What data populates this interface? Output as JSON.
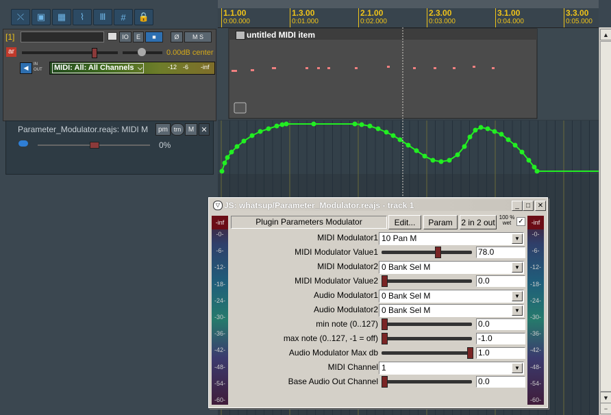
{
  "toolbar": {
    "icons": [
      "ripple-icon",
      "snap-icon",
      "grid-icon",
      "envelope-icon",
      "metronome-icon",
      "grid-lines-icon",
      "lock-icon"
    ]
  },
  "track": {
    "number": "[1]",
    "name_value": "",
    "arm_label": "ar",
    "volume_readout": "0.00dB center",
    "input_label": "MIDI: All: All Channels",
    "io_in": "IN",
    "io_out": "OUT",
    "meter_labels": [
      "-12",
      "-6",
      "-inf"
    ],
    "btn_io": "IO",
    "btn_e": "E",
    "btn_ms": "M S"
  },
  "fx": {
    "name": "Parameter_Modulator.reajs: MIDI M",
    "pm": "pm",
    "trn": "trn",
    "m": "M",
    "percent": "0%"
  },
  "ruler": {
    "marks": [
      {
        "label": "1.1.00",
        "sub": "0:00.000"
      },
      {
        "label": "1.3.00",
        "sub": "0:01.000"
      },
      {
        "label": "2.1.00",
        "sub": "0:02.000"
      },
      {
        "label": "2.3.00",
        "sub": "0:03.000"
      },
      {
        "label": "3.1.00",
        "sub": "0:04.000"
      },
      {
        "label": "3.3.00",
        "sub": "0:05.000"
      }
    ]
  },
  "midi_item": {
    "title": "untitled MIDI item"
  },
  "plugin": {
    "title": "JS: whatsup/Parameter_Modulator.reajs - track 1",
    "header_label": "Plugin Parameters Modulator",
    "btn_edit": "Edit...",
    "btn_param": "Param",
    "btn_io": "2 in 2 out",
    "wet_label": "100 % wet",
    "params": [
      {
        "label": "MIDI Modulator1",
        "type": "combo",
        "value": "10 Pan M"
      },
      {
        "label": "MIDI Modulator Value1",
        "type": "slider",
        "value": "78.0",
        "pos": 0.62
      },
      {
        "label": "MIDI Modulator2",
        "type": "combo",
        "value": "0 Bank Sel M"
      },
      {
        "label": "MIDI Modulator Value2",
        "type": "slider",
        "value": "0.0",
        "pos": 0.0
      },
      {
        "label": "Audio Modulator1",
        "type": "combo",
        "value": "0 Bank Sel M"
      },
      {
        "label": "Audio Modulator2",
        "type": "combo",
        "value": "0 Bank Sel M"
      },
      {
        "label": "min note (0..127)",
        "type": "slider",
        "value": "0.0",
        "pos": 0.0
      },
      {
        "label": "max note (0..127, -1 = off)",
        "type": "slider",
        "value": "-1.0",
        "pos": 0.0
      },
      {
        "label": "Audio Modulator Max db",
        "type": "slider",
        "value": "1.0",
        "pos": 1.0
      },
      {
        "label": "MIDI Channel",
        "type": "combo",
        "value": "1"
      },
      {
        "label": "Base Audio Out Channel",
        "type": "slider",
        "value": "0.0",
        "pos": 0.0
      }
    ],
    "vu_labels": [
      "-0-",
      "-6-",
      "-12-",
      "-18-",
      "-24-",
      "-30-",
      "-36-",
      "-42-",
      "-48-",
      "-54-",
      "-60-"
    ],
    "vu_top": "-inf"
  },
  "colors": {
    "accent_yellow": "#f0c419",
    "envelope_green": "#22ee22",
    "midi_note": "#f08080"
  }
}
